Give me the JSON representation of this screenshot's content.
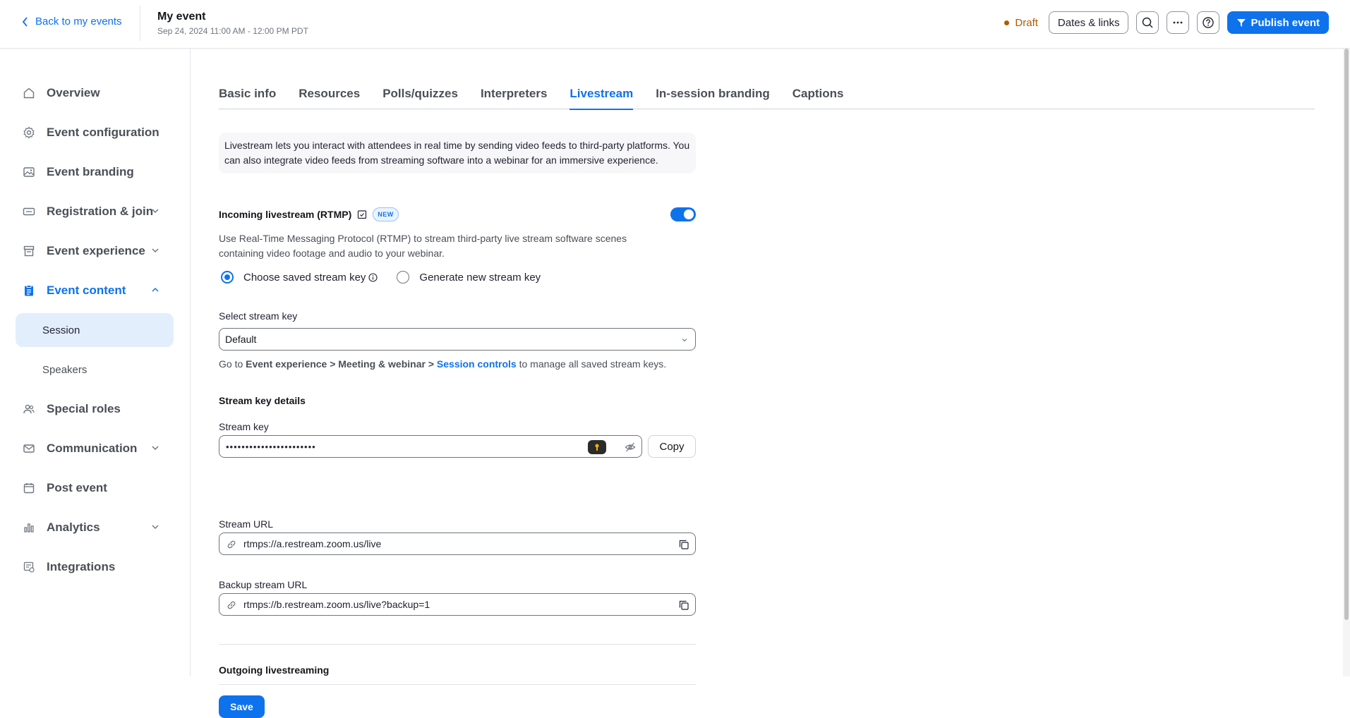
{
  "header": {
    "back_label": "Back to my events",
    "event_title": "My event",
    "event_date": "Sep 24, 2024 11:00 AM - 12:00 PM PDT",
    "status": "Draft",
    "dates_links_label": "Dates & links",
    "publish_label": "Publish event"
  },
  "sidebar": {
    "items": [
      {
        "label": "Overview",
        "icon": "home-icon"
      },
      {
        "label": "Event configuration",
        "icon": "gear-icon"
      },
      {
        "label": "Event branding",
        "icon": "image-icon"
      },
      {
        "label": "Registration & join",
        "icon": "ticket-icon"
      },
      {
        "label": "Event experience",
        "icon": "building-icon"
      },
      {
        "label": "Event content",
        "icon": "clipboard-icon"
      },
      {
        "label": "Special roles",
        "icon": "people-icon"
      },
      {
        "label": "Communication",
        "icon": "mail-icon"
      },
      {
        "label": "Post event",
        "icon": "calendar-icon"
      },
      {
        "label": "Analytics",
        "icon": "bar-chart-icon"
      },
      {
        "label": "Integrations",
        "icon": "integrations-icon"
      }
    ],
    "sub_items": [
      {
        "label": "Session"
      },
      {
        "label": "Speakers"
      }
    ]
  },
  "tabs": [
    {
      "label": "Basic info"
    },
    {
      "label": "Resources"
    },
    {
      "label": "Polls/quizzes"
    },
    {
      "label": "Interpreters"
    },
    {
      "label": "Livestream"
    },
    {
      "label": "In-session branding"
    },
    {
      "label": "Captions"
    }
  ],
  "livestream": {
    "intro": "Livestream lets you interact with attendees in real time by sending video feeds to third-party platforms. You can also integrate video feeds from streaming software into a webinar for an immersive experience.",
    "incoming_title": "Incoming livestream (RTMP)",
    "new_badge": "NEW",
    "incoming_enabled": true,
    "incoming_desc": "Use Real-Time Messaging Protocol (RTMP) to stream third-party live stream software scenes containing video footage and audio to your webinar.",
    "radio_saved": "Choose saved stream key",
    "radio_generate": "Generate new stream key",
    "select_label": "Select stream key",
    "select_value": "Default",
    "hint_prefix": "Go to",
    "hint_path": "Event experience > Meeting & webinar >",
    "hint_link": "Session controls",
    "hint_suffix": "to manage all saved stream keys.",
    "details_title": "Stream key details",
    "stream_key_label": "Stream key",
    "stream_key_value": "•••••••••••••••••••••••",
    "copy_label": "Copy",
    "stream_url_label": "Stream URL",
    "stream_url_value": "rtmps://a.restream.zoom.us/live",
    "backup_url_label": "Backup stream URL",
    "backup_url_value": "rtmps://b.restream.zoom.us/live?backup=1",
    "outgoing_title": "Outgoing livestreaming",
    "save_label": "Save"
  },
  "colors": {
    "accent": "#0e72ed",
    "draft": "#b35900",
    "selected_bg": "#e3eefd"
  }
}
